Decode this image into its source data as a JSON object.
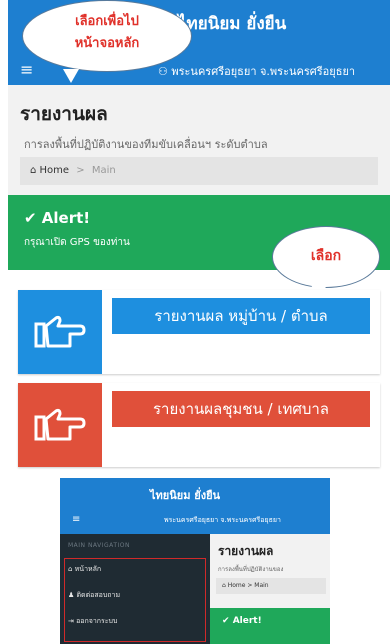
{
  "header": {
    "title": "ไทยนิยม ยั่งยืน",
    "menu_icon": "hamburger-icon",
    "location": "พระนครศรีอยุธยา จ.พระนครศรีอยุธยา"
  },
  "callouts": {
    "back_home": "เลือกเพื่อไป\nหน้าจอหลัก",
    "choose": "เลือก"
  },
  "page": {
    "title": "รายงานผล",
    "subtitle": "การลงพื้นที่ปฏิบัติงานของทีมขับเคลื่อนฯ ระดับตำบล",
    "breadcrumb": {
      "home": "Home",
      "current": "Main"
    }
  },
  "alert": {
    "title": "Alert!",
    "text": "กรุณาเปิด GPS ของท่าน"
  },
  "cards": [
    {
      "label": "รายงานผล หมู่บ้าน / ตำบล",
      "color": "#1e8fdf",
      "icon": "pointing-hand-icon"
    },
    {
      "label": "รายงานผลชุมชน / เทศบาล",
      "color": "#e0503a",
      "icon": "pointing-hand-icon"
    }
  ],
  "mini": {
    "title": "ไทยนิยม ยั่งยืน",
    "location": "พระนครศรีอยุธยา จ.พระนครศรีอยุธยา",
    "nav_label": "MAIN NAVIGATION",
    "nav_items": [
      "หน้าหลัก",
      "ติดต่อสอบถาม",
      "ออกจากระบบ"
    ],
    "page_title": "รายงานผล",
    "page_subtitle": "การลงพื้นที่ปฏิบัติงานของ",
    "breadcrumb": {
      "home": "Home",
      "current": "Main"
    },
    "alert": "Alert!"
  }
}
